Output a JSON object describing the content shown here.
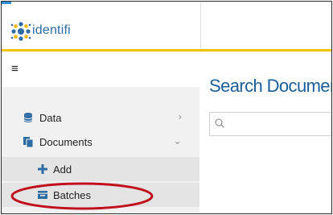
{
  "app": {
    "brand": "identifi"
  },
  "header": {
    "menu_glyph": "≡"
  },
  "sidebar": {
    "items": [
      {
        "label": "Data",
        "icon": "database-icon",
        "chevron": "›"
      },
      {
        "label": "Documents",
        "icon": "documents-icon",
        "chevron": "⌄"
      },
      {
        "label": "Add",
        "icon": "plus-icon"
      },
      {
        "label": "Batches",
        "icon": "batches-icon"
      }
    ]
  },
  "main": {
    "title": "Search Documents",
    "search_placeholder": ""
  },
  "colors": {
    "accent": "#2e6ca4",
    "rule": "#f4c400",
    "sidebar_bg": "#f1f1f1",
    "highlight": "#c0101e"
  }
}
